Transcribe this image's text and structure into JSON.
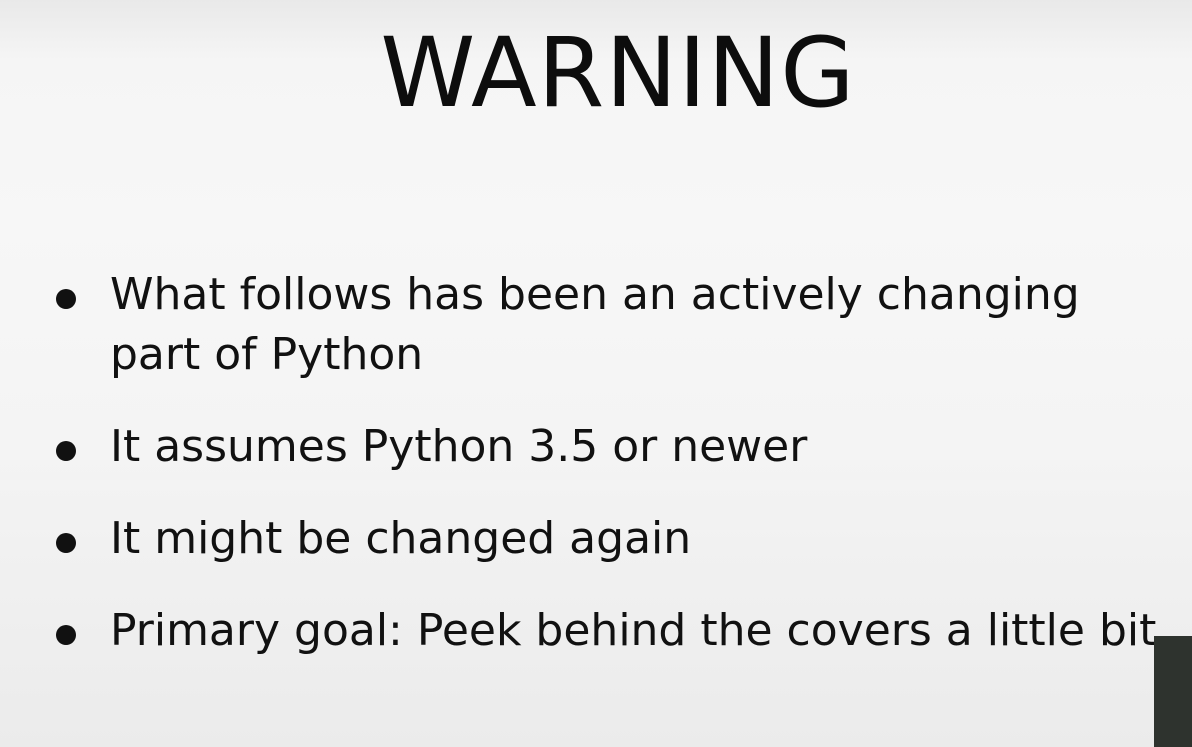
{
  "slide": {
    "title": "WARNING",
    "bullets": [
      "What follows has been an actively changing part of Python",
      "It assumes Python 3.5 or newer",
      "It might be changed again",
      "Primary goal: Peek behind the covers a little bit"
    ]
  }
}
